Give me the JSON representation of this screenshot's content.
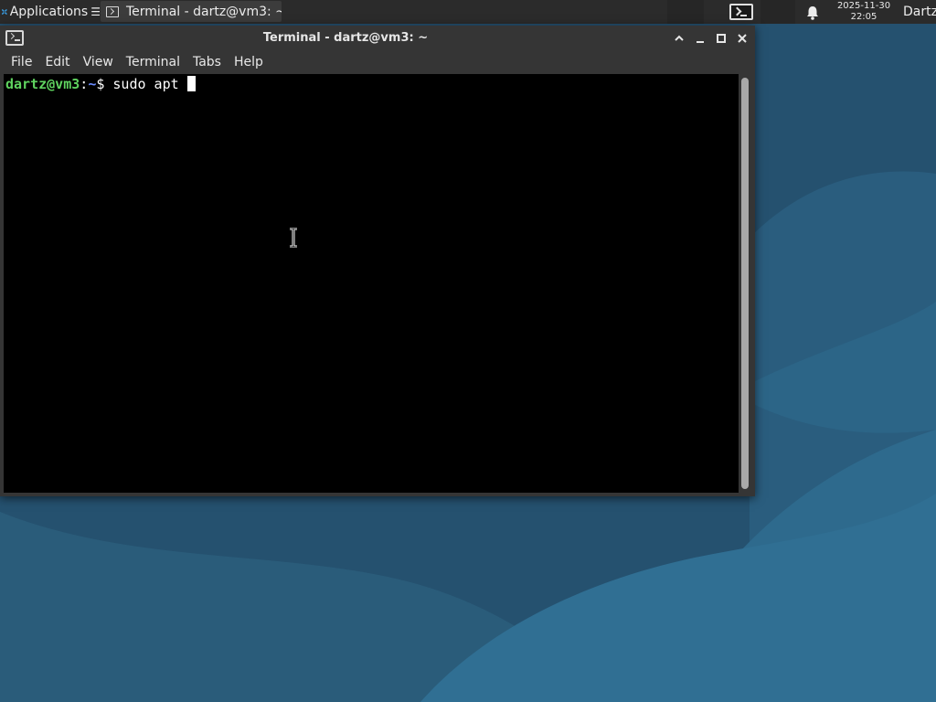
{
  "panel": {
    "applications_label": "Applications",
    "taskbar_window_title": "Terminal - dartz@vm3: ~",
    "clock_date": "2025-11-30",
    "clock_time": "22:05",
    "user_label": "Dartz"
  },
  "window": {
    "title": "Terminal - dartz@vm3: ~",
    "menu": [
      "File",
      "Edit",
      "View",
      "Terminal",
      "Tabs",
      "Help"
    ]
  },
  "terminal": {
    "prompt_user": "dartz@vm3",
    "prompt_separator": ":",
    "prompt_path": "~",
    "prompt_symbol": "$ ",
    "command": "sudo apt "
  },
  "colors": {
    "panel_bg": "#2b2b2b",
    "window_bg": "#353535",
    "terminal_bg": "#000000",
    "prompt_user": "#5fd35f",
    "prompt_path": "#6b8cff",
    "desktop_bg": "#25516f"
  },
  "icons": {
    "app_menu": "xfce-logo-icon",
    "taskbar": "terminal-icon",
    "notifications": "bell-icon",
    "window_controls": [
      "shade-icon",
      "minimize-icon",
      "maximize-icon",
      "close-icon"
    ]
  }
}
